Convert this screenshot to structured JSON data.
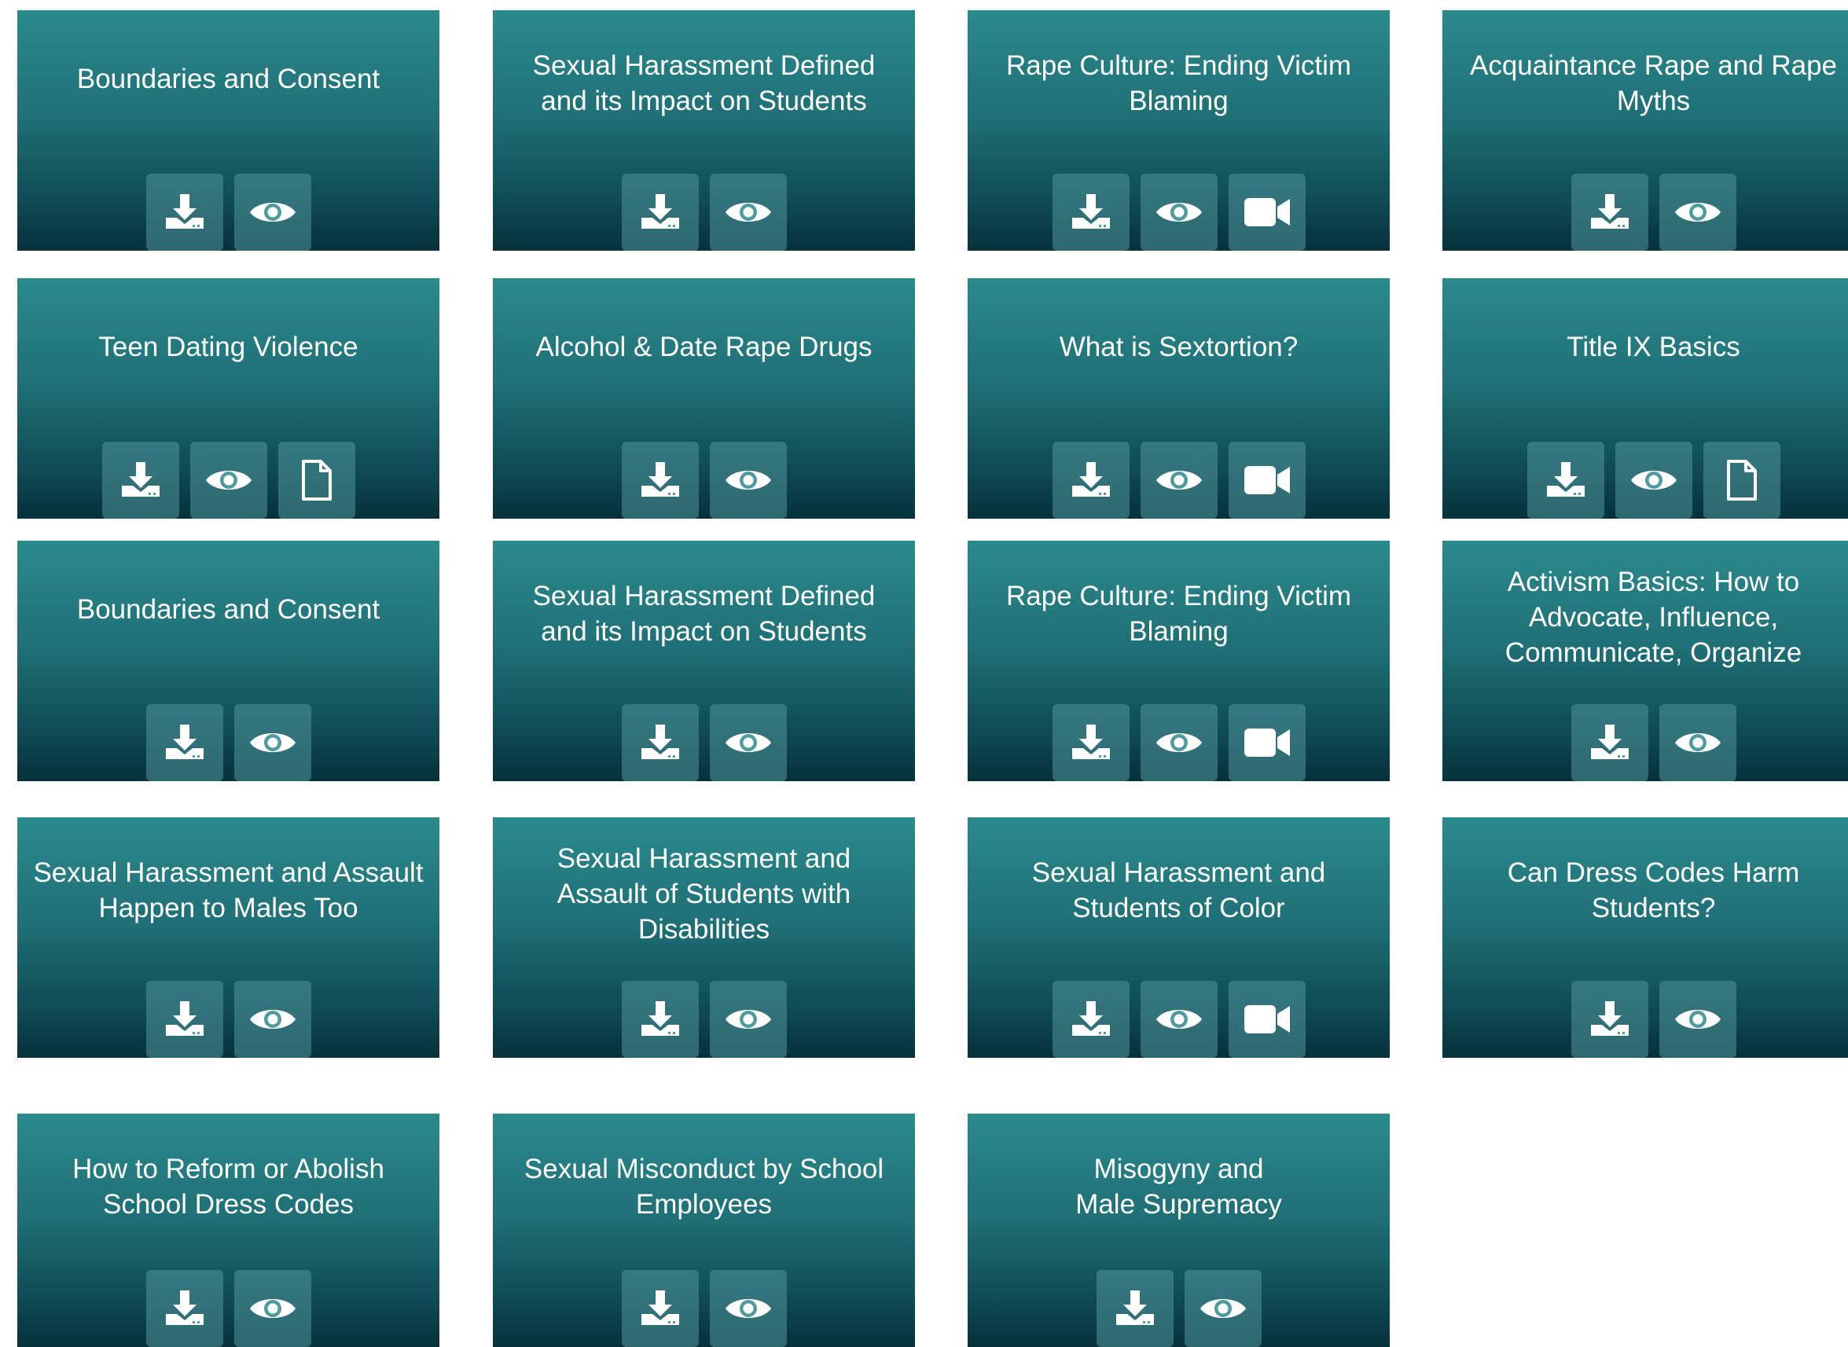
{
  "colors": {
    "card_top": "#2b8a8c",
    "card_bottom": "#06313b",
    "button_bg": "#4e9a9e",
    "text": "#ffffff"
  },
  "cards": [
    {
      "title": "Boundaries and Consent",
      "actions": [
        "download-icon",
        "eye-icon"
      ]
    },
    {
      "title": "Sexual Harassment Defined\nand its Impact on Students",
      "actions": [
        "download-icon",
        "eye-icon"
      ]
    },
    {
      "title": "Rape Culture: Ending Victim\nBlaming",
      "actions": [
        "download-icon",
        "eye-icon",
        "video-camera-icon"
      ]
    },
    {
      "title": "Acquaintance Rape and Rape\nMyths",
      "actions": [
        "download-icon",
        "eye-icon"
      ]
    },
    {
      "title": "Teen Dating Violence",
      "actions": [
        "download-icon",
        "eye-icon",
        "document-icon"
      ]
    },
    {
      "title": "Alcohol & Date Rape Drugs",
      "actions": [
        "download-icon",
        "eye-icon"
      ]
    },
    {
      "title": "What is Sextortion?",
      "actions": [
        "download-icon",
        "eye-icon",
        "video-camera-icon"
      ]
    },
    {
      "title": "Title IX Basics",
      "actions": [
        "download-icon",
        "eye-icon",
        "document-icon"
      ]
    },
    {
      "title": "Boundaries and Consent",
      "actions": [
        "download-icon",
        "eye-icon"
      ]
    },
    {
      "title": "Sexual Harassment Defined\nand its Impact on Students",
      "actions": [
        "download-icon",
        "eye-icon"
      ]
    },
    {
      "title": "Rape Culture: Ending Victim\nBlaming",
      "actions": [
        "download-icon",
        "eye-icon",
        "video-camera-icon"
      ]
    },
    {
      "title": "Activism Basics: How to\nAdvocate, Influence,\nCommunicate, Organize",
      "actions": [
        "download-icon",
        "eye-icon"
      ]
    },
    {
      "title": "Sexual Harassment and Assault\nHappen to Males Too",
      "actions": [
        "download-icon",
        "eye-icon"
      ]
    },
    {
      "title": "Sexual Harassment and\nAssault of Students with\nDisabilities",
      "actions": [
        "download-icon",
        "eye-icon"
      ]
    },
    {
      "title": "Sexual Harassment and\nStudents of Color",
      "actions": [
        "download-icon",
        "eye-icon",
        "video-camera-icon"
      ]
    },
    {
      "title": "Can Dress Codes Harm\nStudents?",
      "actions": [
        "download-icon",
        "eye-icon"
      ]
    },
    {
      "title": "How to Reform or Abolish\nSchool Dress Codes",
      "actions": [
        "download-icon",
        "eye-icon"
      ]
    },
    {
      "title": "Sexual Misconduct by School\nEmployees",
      "actions": [
        "download-icon",
        "eye-icon"
      ]
    },
    {
      "title": "Misogyny and\nMale Supremacy",
      "actions": [
        "download-icon",
        "eye-icon"
      ]
    }
  ]
}
